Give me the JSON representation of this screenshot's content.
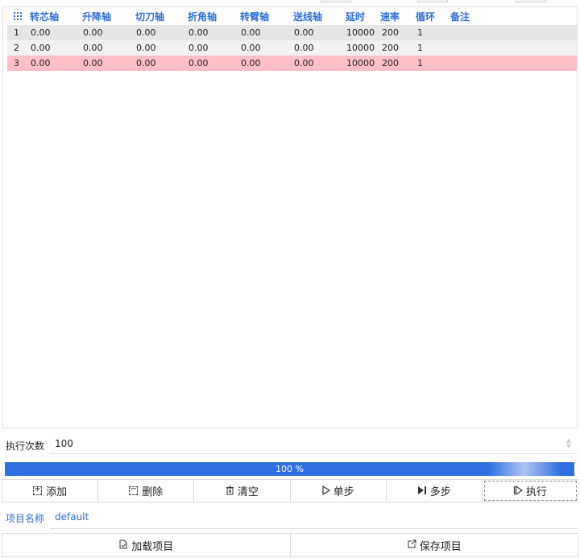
{
  "table": {
    "columns": [
      "转芯轴",
      "升降轴",
      "切刀轴",
      "折角轴",
      "转臂轴",
      "送线轴",
      "延时",
      "速率",
      "循环",
      "备注"
    ],
    "rows": [
      {
        "index": "1",
        "cells": [
          "0.00",
          "0.00",
          "0.00",
          "0.00",
          "0.00",
          "0.00",
          "10000",
          "200",
          "1",
          ""
        ]
      },
      {
        "index": "2",
        "cells": [
          "0.00",
          "0.00",
          "0.00",
          "0.00",
          "0.00",
          "0.00",
          "10000",
          "200",
          "1",
          ""
        ]
      },
      {
        "index": "3",
        "cells": [
          "0.00",
          "0.00",
          "0.00",
          "0.00",
          "0.00",
          "0.00",
          "10000",
          "200",
          "1",
          ""
        ]
      }
    ],
    "selected_row": 3,
    "colors": {
      "header": "#2e6fd6",
      "selected_row": "#ffbfc8"
    }
  },
  "exec_count": {
    "label": "执行次数",
    "value": "100"
  },
  "progress": {
    "value": 100,
    "text": "100 %",
    "color": "#2f6fe0"
  },
  "buttons": {
    "add": "添加",
    "delete": "删除",
    "clear": "清空",
    "step": "单步",
    "multi_step": "多步",
    "execute": "执行"
  },
  "project": {
    "label": "项目名称",
    "value": "default"
  },
  "bottom_buttons": {
    "load": "加载项目",
    "save": "保存项目"
  },
  "icons": {
    "column_menu": "grid-dots-icon",
    "add": "add-box-icon",
    "delete": "delete-box-icon",
    "clear": "trash-icon",
    "step": "play-outline-icon",
    "multi_step": "step-forward-icon",
    "execute": "play-outline-icon",
    "load": "load-file-icon",
    "save": "export-file-icon",
    "spinner": "spin-arrows-icon"
  }
}
